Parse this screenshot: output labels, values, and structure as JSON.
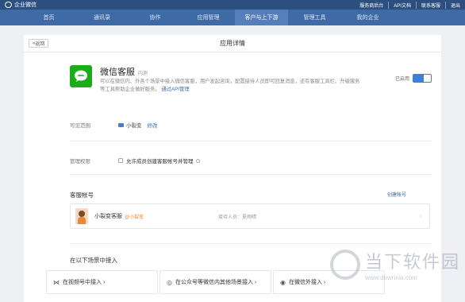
{
  "topbar": {
    "brand": "企业微信",
    "links": [
      "服务商后台",
      "API文档",
      "联系客服",
      "退出"
    ]
  },
  "nav": {
    "items": [
      "首页",
      "通讯录",
      "协作",
      "应用管理",
      "客户与上下游",
      "管理工具",
      "我的企业"
    ],
    "active_index": 4
  },
  "page": {
    "back_label": "返回",
    "title": "应用详情"
  },
  "app": {
    "name": "微信客服",
    "tag": "内测",
    "desc": "可以在微信内、外各个场景中接入微信客服，用户发起咨询，配置接待人员即可回复消息，还有客服工具栏、升级服务等工具帮助企业做好服务。",
    "api_link": "通过API管理",
    "enabled_label": "已启用",
    "enabled": true,
    "icon": "chat-bubble-icon"
  },
  "visibility": {
    "label": "可见范围",
    "dept": "小裂变",
    "edit_label": "修改"
  },
  "permission": {
    "label": "管理权限",
    "checkbox_label": "允许成员创建客服帐号并管理",
    "checked": false
  },
  "accounts": {
    "title": "客服帐号",
    "create_label": "创建帐号",
    "items": [
      {
        "name": "小裂变客服",
        "owner": "@小裂变",
        "staff": "接待人员：夏雨晴"
      }
    ]
  },
  "scenes": {
    "title": "在以下场景中接入",
    "items": [
      {
        "icon": "video-channel-icon",
        "label": "在视频号中接入 ›"
      },
      {
        "icon": "official-account-icon",
        "label": "在公众号等微信内其他场景接入 ›"
      },
      {
        "icon": "chat-icon",
        "label": "在微信外接入 ›"
      }
    ]
  },
  "watermark": {
    "big": "当下软件园",
    "small": "www.downxia.com"
  },
  "colors": {
    "topbar": "#2d4f7f",
    "nav": "#3e6aa6",
    "nav_active": "#557fbb",
    "app_icon": "#1aad19",
    "toggle": "#3e80d8",
    "link": "#3e6aa6",
    "owner": "#e58a3a"
  }
}
